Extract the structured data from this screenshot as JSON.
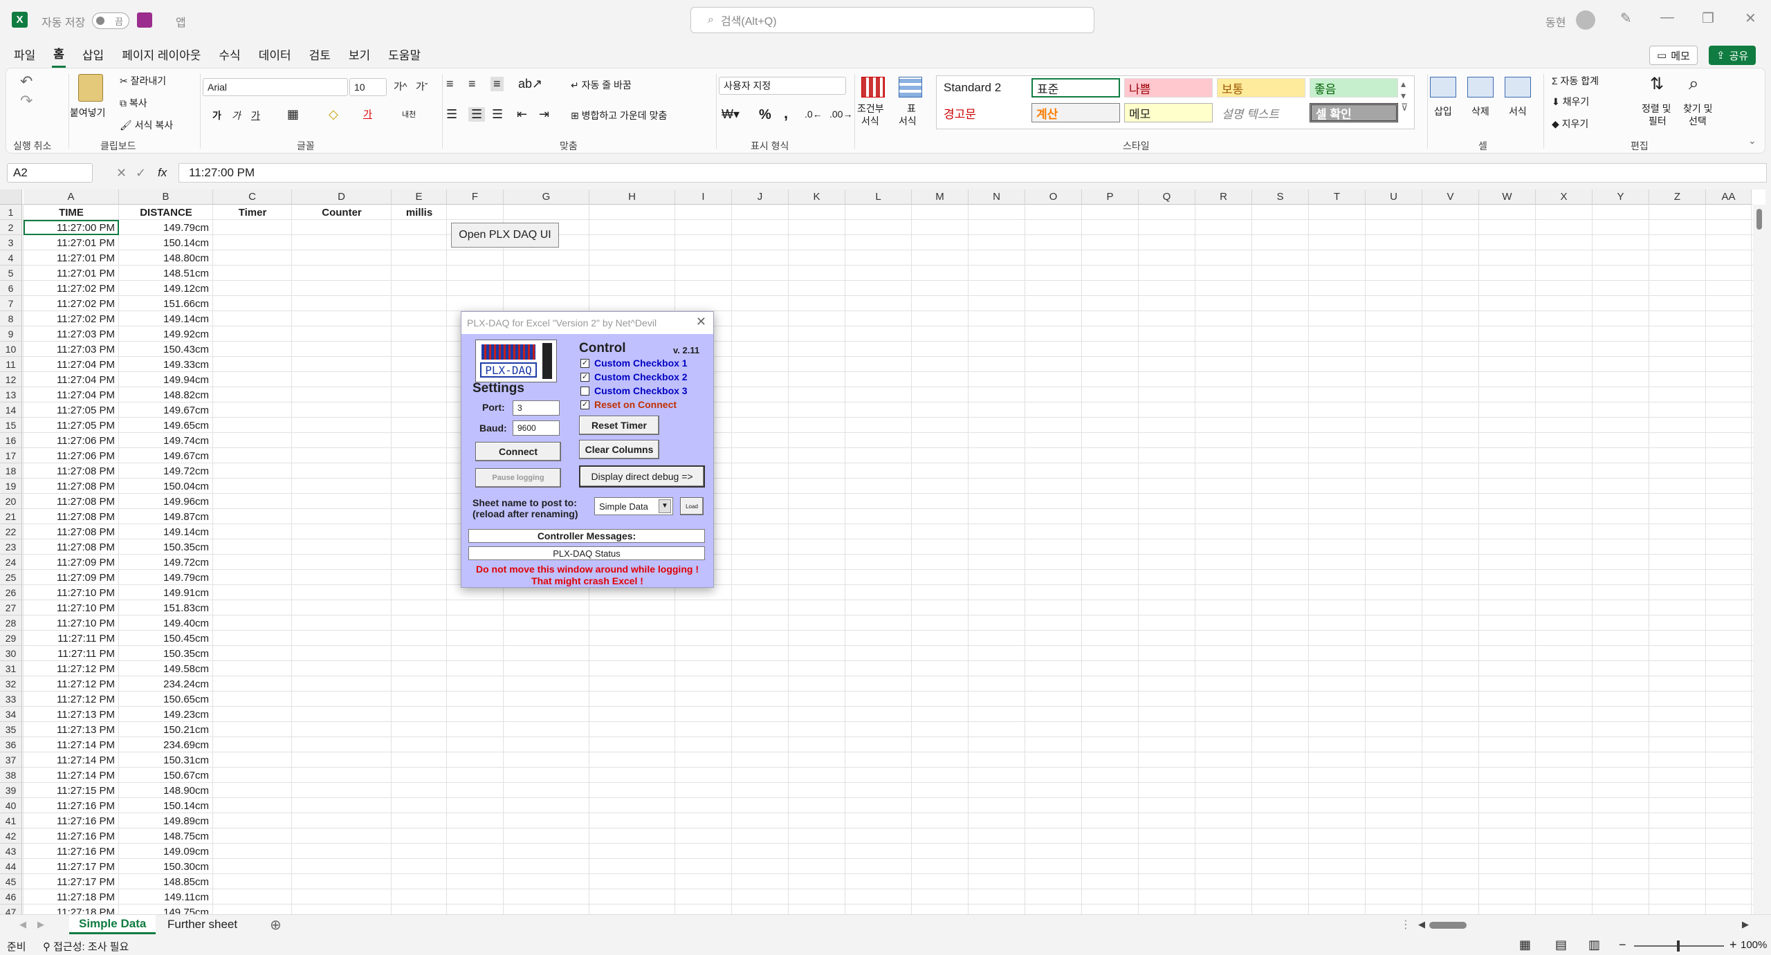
{
  "titlebar": {
    "autosave": "자동 저장",
    "toggle": "끔",
    "app_hint": "앱",
    "search": "검색(Alt+Q)",
    "user": "동현"
  },
  "menu": [
    "파일",
    "홈",
    "삽입",
    "페이지 레이아웃",
    "수식",
    "데이터",
    "검토",
    "보기",
    "도움말"
  ],
  "menu_right": {
    "memo": "메모",
    "share": "공유"
  },
  "ribbon": {
    "undo_label": "실행 취소",
    "clipboard": {
      "paste": "붙여넣기",
      "cut": "잘라내기",
      "copy": "복사",
      "format_painter": "서식 복사",
      "label": "클립보드"
    },
    "font": {
      "name": "Arial",
      "size": "10",
      "label": "글꼴",
      "grow": "가^",
      "shrink": "가ˇ",
      "bold": "가",
      "italic": "가",
      "underline": "가",
      "color_label": "가",
      "phonetic": "내천"
    },
    "align": {
      "wrap": "자동 줄 바꿈",
      "merge": "병합하고 가운데 맞춤",
      "label": "맞춤"
    },
    "number": {
      "format": "사용자 지정",
      "pct": "%",
      "comma": ",",
      "label": "표시 형식"
    },
    "styles": {
      "cond": "조건부",
      "cond2": "서식",
      "table": "표",
      "table2": "서식",
      "std2": "Standard 2",
      "normal": "표준",
      "bad": "나쁨",
      "neutral": "보통",
      "good": "좋음",
      "warning": "경고문",
      "calc": "계산",
      "note": "메모",
      "explain": "설명 텍스트",
      "check": "셀 확인",
      "label": "스타일"
    },
    "cells": {
      "insert": "삽입",
      "delete": "삭제",
      "format": "서식",
      "label": "셀"
    },
    "editing": {
      "autosum": "자동 합계",
      "fill": "채우기",
      "clear": "지우기",
      "sort": "정렬 및",
      "sort2": "필터",
      "find": "찾기 및",
      "find2": "선택",
      "label": "편집"
    }
  },
  "formula": {
    "namebox": "A2",
    "fx": "fx",
    "value": "11:27:00 PM"
  },
  "columns": [
    "A",
    "B",
    "C",
    "D",
    "E",
    "F",
    "G",
    "H",
    "I",
    "J",
    "K",
    "L",
    "M",
    "N",
    "O",
    "P",
    "Q",
    "R",
    "S",
    "T",
    "U",
    "V",
    "W",
    "X",
    "Y",
    "Z",
    "AA"
  ],
  "headers": {
    "A": "TIME",
    "B": "DISTANCE",
    "C": "Timer",
    "D": "Counter",
    "E": "millis"
  },
  "rows": [
    [
      "11:27:00 PM",
      "149.79cm"
    ],
    [
      "11:27:01 PM",
      "150.14cm"
    ],
    [
      "11:27:01 PM",
      "148.80cm"
    ],
    [
      "11:27:01 PM",
      "148.51cm"
    ],
    [
      "11:27:02 PM",
      "149.12cm"
    ],
    [
      "11:27:02 PM",
      "151.66cm"
    ],
    [
      "11:27:02 PM",
      "149.14cm"
    ],
    [
      "11:27:03 PM",
      "149.92cm"
    ],
    [
      "11:27:03 PM",
      "150.43cm"
    ],
    [
      "11:27:04 PM",
      "149.33cm"
    ],
    [
      "11:27:04 PM",
      "149.94cm"
    ],
    [
      "11:27:04 PM",
      "148.82cm"
    ],
    [
      "11:27:05 PM",
      "149.67cm"
    ],
    [
      "11:27:05 PM",
      "149.65cm"
    ],
    [
      "11:27:06 PM",
      "149.74cm"
    ],
    [
      "11:27:06 PM",
      "149.67cm"
    ],
    [
      "11:27:08 PM",
      "149.72cm"
    ],
    [
      "11:27:08 PM",
      "150.04cm"
    ],
    [
      "11:27:08 PM",
      "149.96cm"
    ],
    [
      "11:27:08 PM",
      "149.87cm"
    ],
    [
      "11:27:08 PM",
      "149.14cm"
    ],
    [
      "11:27:08 PM",
      "150.35cm"
    ],
    [
      "11:27:09 PM",
      "149.72cm"
    ],
    [
      "11:27:09 PM",
      "149.79cm"
    ],
    [
      "11:27:10 PM",
      "149.91cm"
    ],
    [
      "11:27:10 PM",
      "151.83cm"
    ],
    [
      "11:27:10 PM",
      "149.40cm"
    ],
    [
      "11:27:11 PM",
      "150.45cm"
    ],
    [
      "11:27:11 PM",
      "150.35cm"
    ],
    [
      "11:27:12 PM",
      "149.58cm"
    ],
    [
      "11:27:12 PM",
      "234.24cm"
    ],
    [
      "11:27:12 PM",
      "150.65cm"
    ],
    [
      "11:27:13 PM",
      "149.23cm"
    ],
    [
      "11:27:13 PM",
      "150.21cm"
    ],
    [
      "11:27:14 PM",
      "234.69cm"
    ],
    [
      "11:27:14 PM",
      "150.31cm"
    ],
    [
      "11:27:14 PM",
      "150.67cm"
    ],
    [
      "11:27:15 PM",
      "148.90cm"
    ],
    [
      "11:27:16 PM",
      "150.14cm"
    ],
    [
      "11:27:16 PM",
      "149.89cm"
    ],
    [
      "11:27:16 PM",
      "148.75cm"
    ],
    [
      "11:27:16 PM",
      "149.09cm"
    ],
    [
      "11:27:17 PM",
      "150.30cm"
    ],
    [
      "11:27:17 PM",
      "148.85cm"
    ],
    [
      "11:27:18 PM",
      "149.11cm"
    ],
    [
      "11:27:18 PM",
      "149.75cm"
    ]
  ],
  "open_plx_button": "Open PLX DAQ UI",
  "plx": {
    "title": "PLX-DAQ for Excel \"Version 2\" by Net^Devil",
    "logo": "PLX-DAQ",
    "control": "Control",
    "version": "v. 2.11",
    "checkboxes": [
      {
        "label": "Custom Checkbox 1",
        "checked": true
      },
      {
        "label": "Custom Checkbox 2",
        "checked": true
      },
      {
        "label": "Custom Checkbox 3",
        "checked": false
      },
      {
        "label": "Reset on Connect",
        "checked": true
      }
    ],
    "settings": "Settings",
    "port_label": "Port:",
    "port": "3",
    "baud_label": "Baud:",
    "baud": "9600",
    "connect": "Connect",
    "reset_timer": "Reset Timer",
    "clear_columns": "Clear Columns",
    "pause": "Pause logging",
    "debug": "Display direct debug =>",
    "sheet_label1": "Sheet name to post to:",
    "sheet_label2": "(reload after renaming)",
    "sheet": "Simple Data",
    "load": "Load",
    "ctrl_msgs": "Controller Messages:",
    "status": "PLX-DAQ Status",
    "warn1": "Do not move this window around while logging !",
    "warn2": "That might crash Excel !"
  },
  "sheets": [
    "Simple Data",
    "Further sheet"
  ],
  "status": {
    "ready": "준비",
    "access": "접근성: 조사 필요",
    "zoom": "100%"
  }
}
